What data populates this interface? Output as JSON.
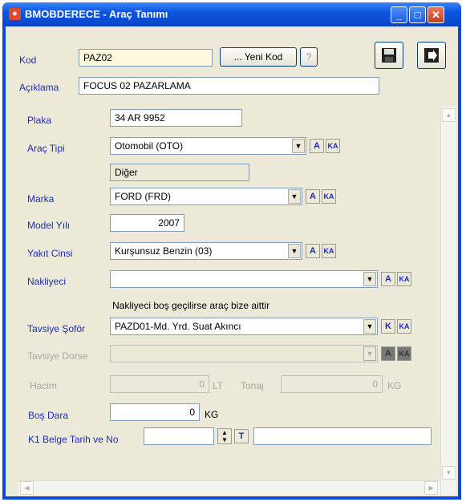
{
  "window": {
    "title": "BMOBDERECE - Araç Tanımı"
  },
  "header": {
    "kod_label": "Kod",
    "kod_value": "PAZ02",
    "yeni_kod_label": "... Yeni Kod",
    "help_label": "?",
    "aciklama_label": "Açıklama",
    "aciklama_value": "FOCUS 02 PAZARLAMA"
  },
  "form": {
    "plaka_label": "Plaka",
    "plaka_value": "34 AR 9952",
    "arac_tipi_label": "Araç Tipi",
    "arac_tipi_value": "Otomobil (OTO)",
    "arac_tipi_sub": "Diğer",
    "marka_label": "Marka",
    "marka_value": "FORD (FRD)",
    "model_yili_label": "Model Yılı",
    "model_yili_value": "2007",
    "yakit_label": "Yakıt Cinsi",
    "yakit_value": "Kurşunsuz Benzin (03)",
    "nakliyeci_label": "Nakliyeci",
    "nakliyeci_value": "",
    "nakliyeci_note": "Nakliyeci boş geçilirse araç bize aittir",
    "tavsiye_sofor_label": "Tavsiye Şoför",
    "tavsiye_sofor_value": "PAZD01-Md. Yrd. Suat Akıncı",
    "tavsiye_dorse_label": "Tavsiye Dorse",
    "tavsiye_dorse_value": "",
    "hacim_label": "Hacim",
    "hacim_value": "0",
    "hacim_unit": "LT",
    "tonaj_label": "Tonaj",
    "tonaj_value": "0",
    "tonaj_unit": "KG",
    "bos_dara_label": "Boş Dara",
    "bos_dara_value": "0",
    "bos_dara_unit": "KG",
    "k1_label": "K1 Belge Tarih ve No",
    "k1_date": "",
    "k1_no": ""
  },
  "icons": {
    "save": "save-icon",
    "exit": "exit-icon",
    "a_letter": "A",
    "k_letter": "K",
    "ka_letter": "KA",
    "t_letter": "T"
  }
}
